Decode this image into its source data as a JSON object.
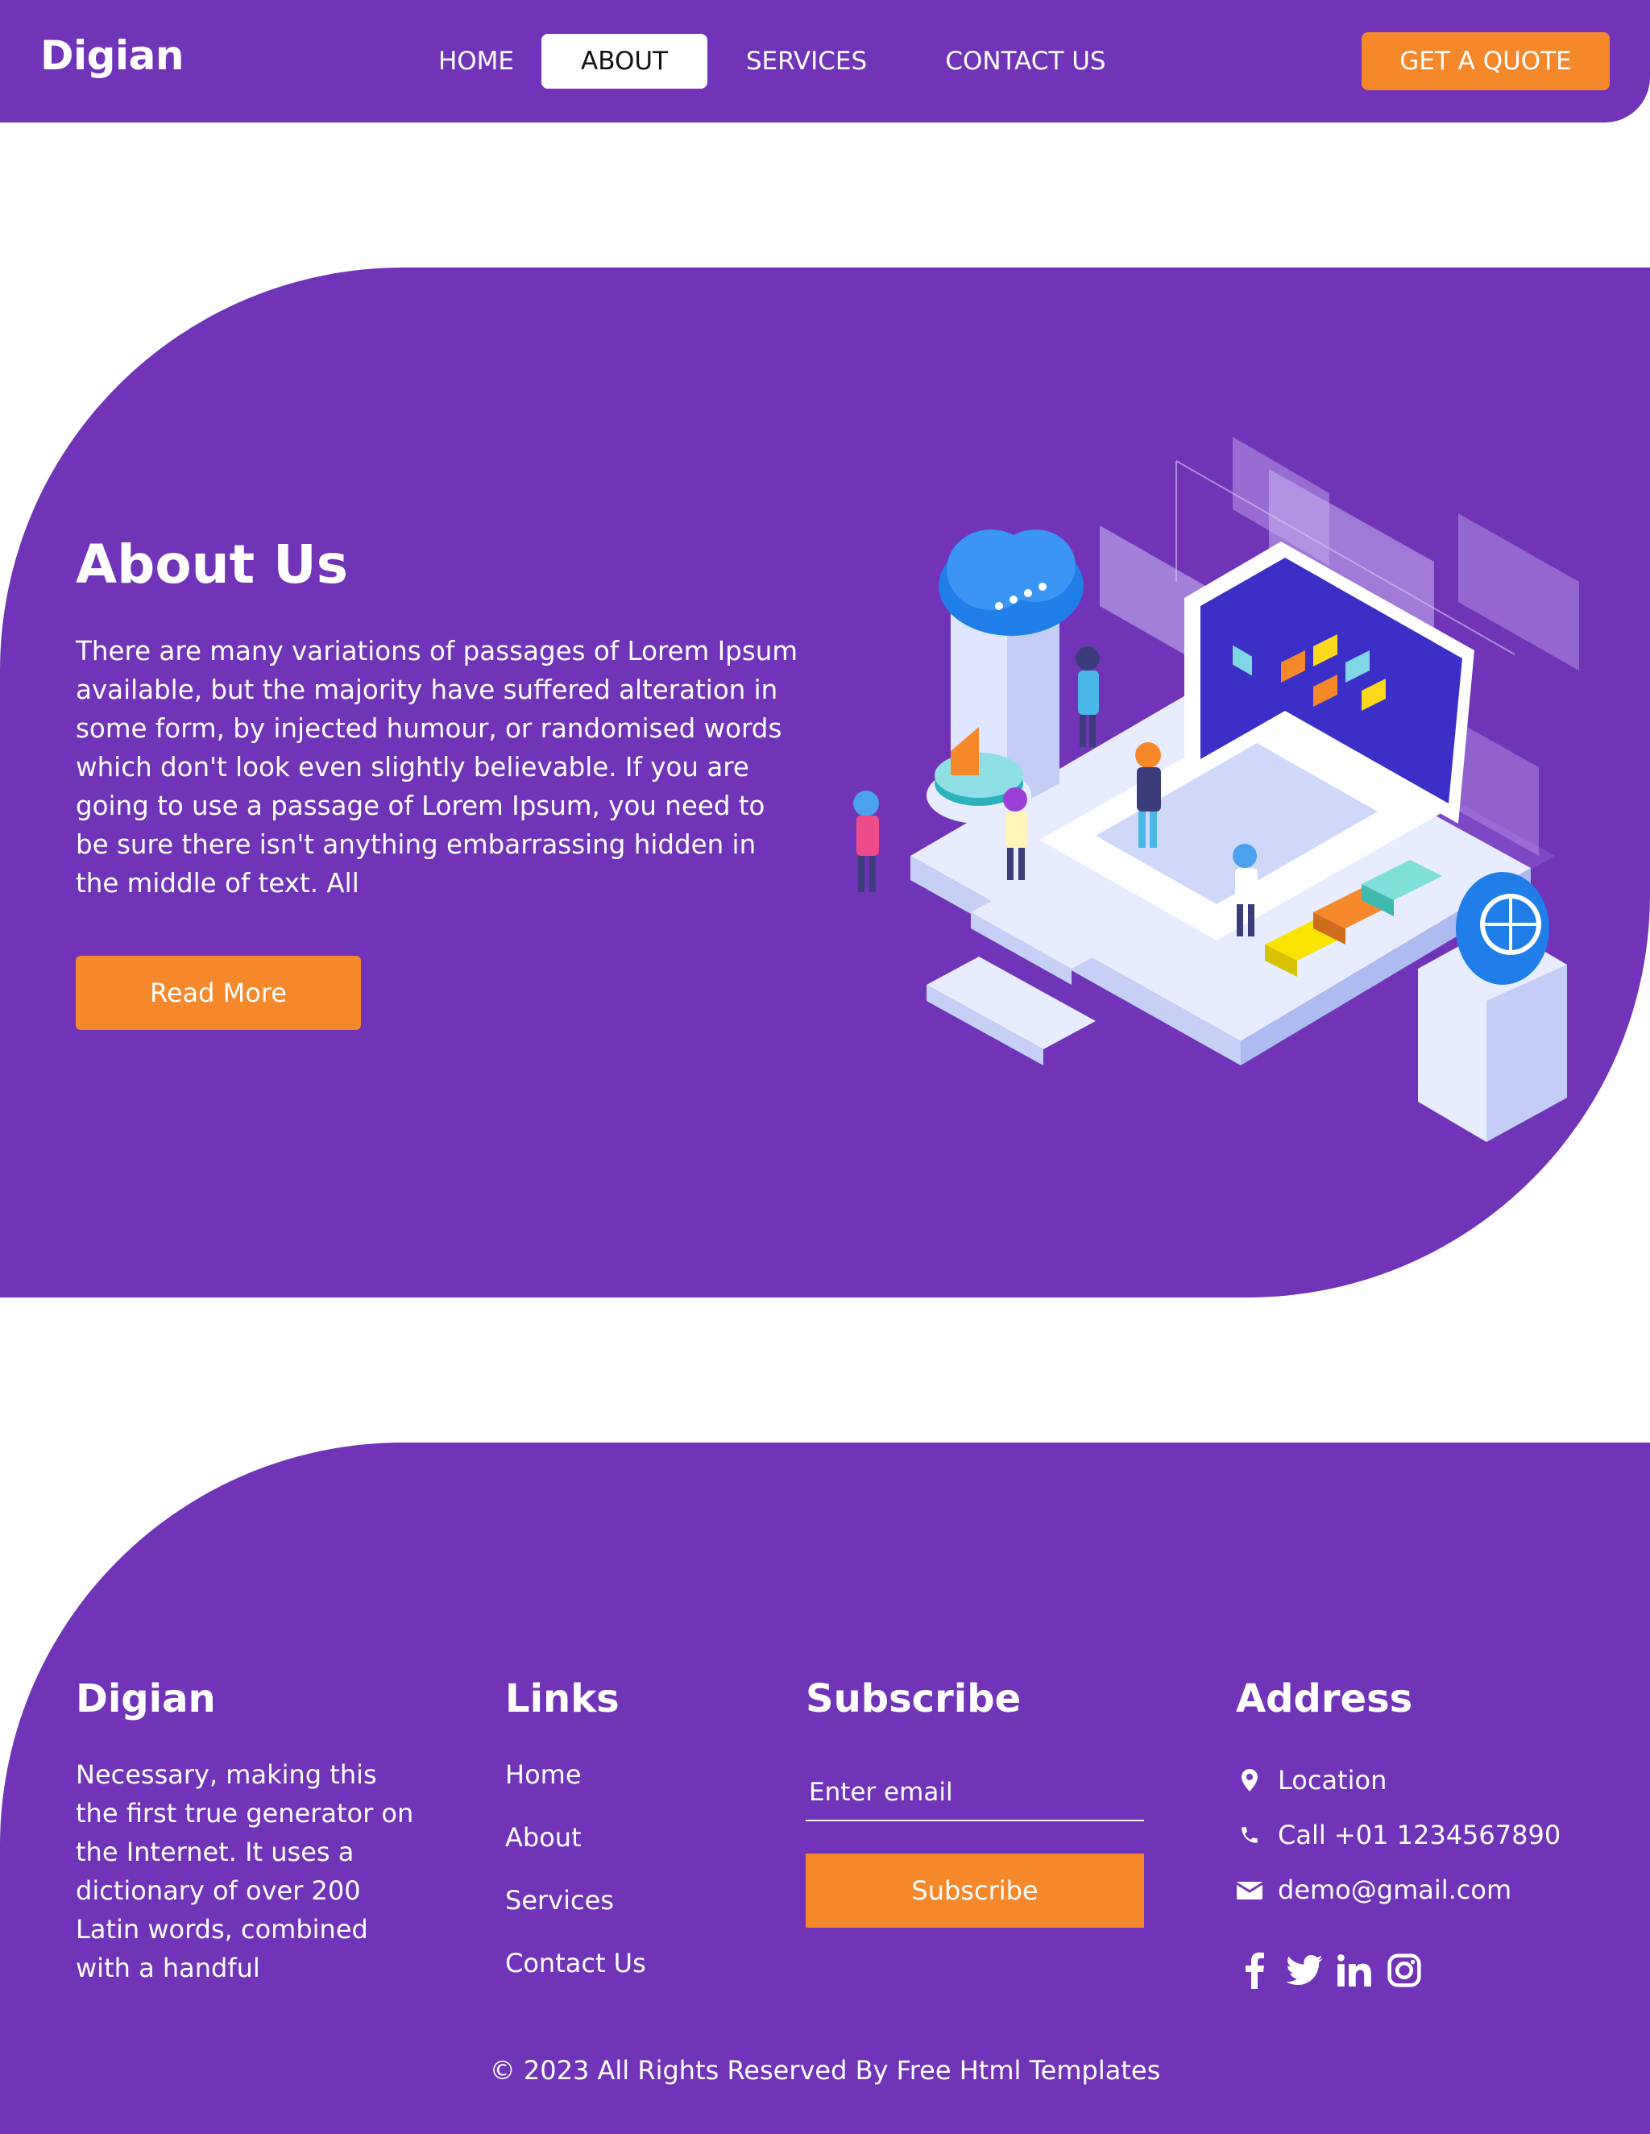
{
  "header": {
    "brand": "Digian",
    "nav": [
      "HOME",
      "ABOUT",
      "SERVICES",
      "CONTACT US"
    ],
    "active_nav": "ABOUT",
    "cta": "GET A QUOTE"
  },
  "about": {
    "title": "About Us",
    "text": "There are many variations of passages of Lorem Ipsum available, but the majority have suffered alteration in some form, by injected humour, or randomised words which don't look even slightly believable. If you are going to use a passage of Lorem Ipsum, you need to be sure there isn't anything embarrassing hidden in the middle of text. All",
    "button": "Read More"
  },
  "footer": {
    "brand_heading": "Digian",
    "brand_text": "Necessary, making this the first true generator on the Internet. It uses a dictionary of over 200 Latin words, combined with a handful",
    "links_heading": "Links",
    "links": [
      "Home",
      "About",
      "Services",
      "Contact Us"
    ],
    "subscribe_heading": "Subscribe",
    "email_placeholder": "Enter email",
    "subscribe_button": "Subscribe",
    "address_heading": "Address",
    "location": "Location",
    "phone": "Call +01 1234567890",
    "email": "demo@gmail.com",
    "socials": [
      "facebook-icon",
      "twitter-icon",
      "linkedin-icon",
      "instagram-icon"
    ],
    "copyright": "© 2023 All Rights Reserved By Free Html Templates"
  },
  "colors": {
    "purple": "#7134b8",
    "orange": "#f6882c",
    "white": "#ffffff"
  }
}
